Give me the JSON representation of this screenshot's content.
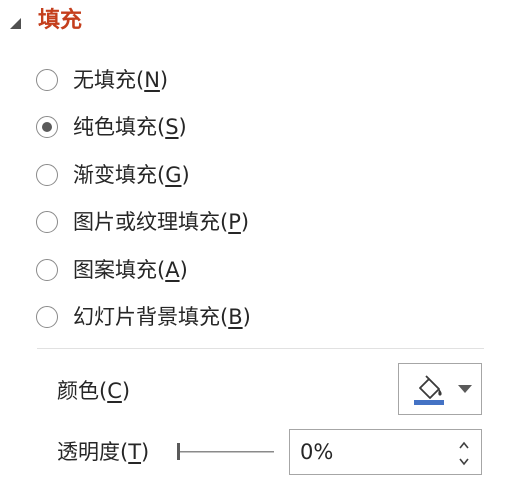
{
  "section": {
    "title": "填充",
    "collapse_icon": "triangle-collapse-icon"
  },
  "fill_options": [
    {
      "text": "无填充(",
      "accel": "N",
      "close": ")",
      "checked": false
    },
    {
      "text": "纯色填充(",
      "accel": "S",
      "close": ")",
      "checked": true
    },
    {
      "text": "渐变填充(",
      "accel": "G",
      "close": ")",
      "checked": false
    },
    {
      "text": "图片或纹理填充(",
      "accel": "P",
      "close": ")",
      "checked": false
    },
    {
      "text": "图案填充(",
      "accel": "A",
      "close": ")",
      "checked": false
    },
    {
      "text": "幻灯片背景填充(",
      "accel": "B",
      "close": ")",
      "checked": false
    }
  ],
  "color": {
    "label_text": "颜色(",
    "label_accel": "C",
    "label_close": ")",
    "icon": "paint-bucket-icon",
    "swatch_color": "#4472c4",
    "dropdown_icon": "dropdown-arrow-icon"
  },
  "transparency": {
    "label_text": "透明度(",
    "label_accel": "T",
    "label_close": ")",
    "value": "0%",
    "slider_level": 0
  },
  "colors": {
    "accent": "#c43e1c",
    "border": "#a6a6a6",
    "divider": "#e1e1e1"
  }
}
